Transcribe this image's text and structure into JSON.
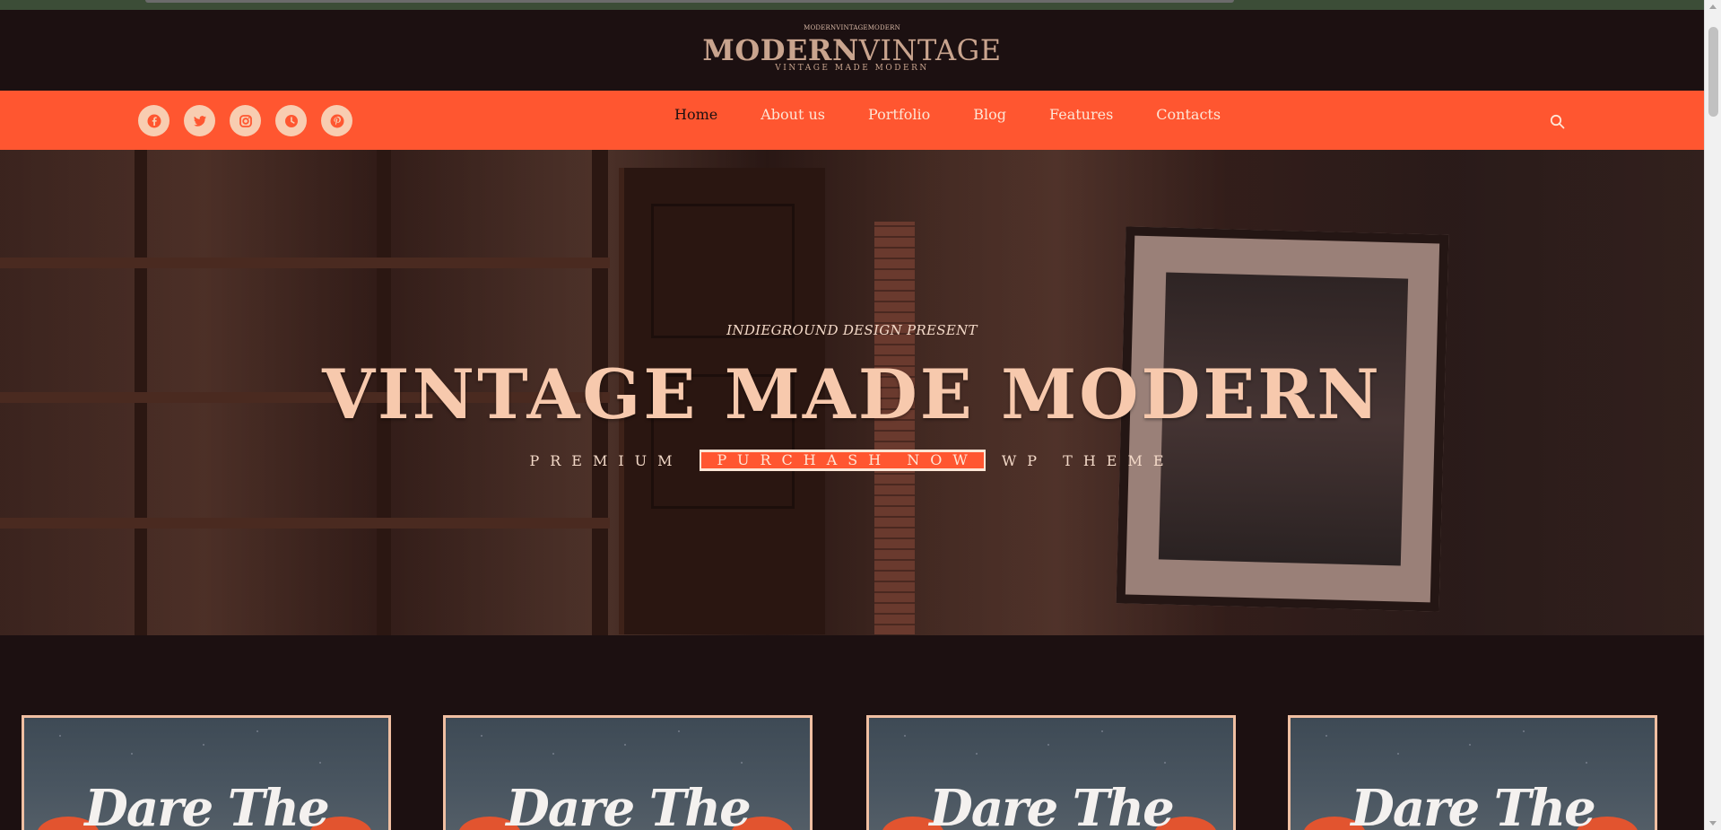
{
  "brand": {
    "top_small": "MODERNVINTAGEMODERN",
    "logo_bold": "MODERN",
    "logo_light": "VINTAGE",
    "tagline": "VINTAGE MADE MODERN"
  },
  "social": [
    "facebook-icon",
    "twitter-icon",
    "instagram-icon",
    "clock-icon",
    "pinterest-icon"
  ],
  "menu": {
    "items": [
      {
        "label": "Home",
        "active": true
      },
      {
        "label": "About us"
      },
      {
        "label": "Portfolio"
      },
      {
        "label": "Blog"
      },
      {
        "label": "Features"
      },
      {
        "label": "Contacts"
      }
    ]
  },
  "hero": {
    "kicker": "INDIEGROUND DESIGN PRESENT",
    "title": "VINTAGE MADE MODERN",
    "sub_left": "PREMIUM",
    "button": "PURCHASH NOW",
    "sub_right": "WP THEME"
  },
  "cards": [
    {
      "text": "Dare The"
    },
    {
      "text": "Dare The"
    },
    {
      "text": "Dare The"
    },
    {
      "text": "Dare The"
    }
  ],
  "colors": {
    "accent": "#ff5630",
    "dark": "#1c1011",
    "peach": "#f7c9ad"
  }
}
